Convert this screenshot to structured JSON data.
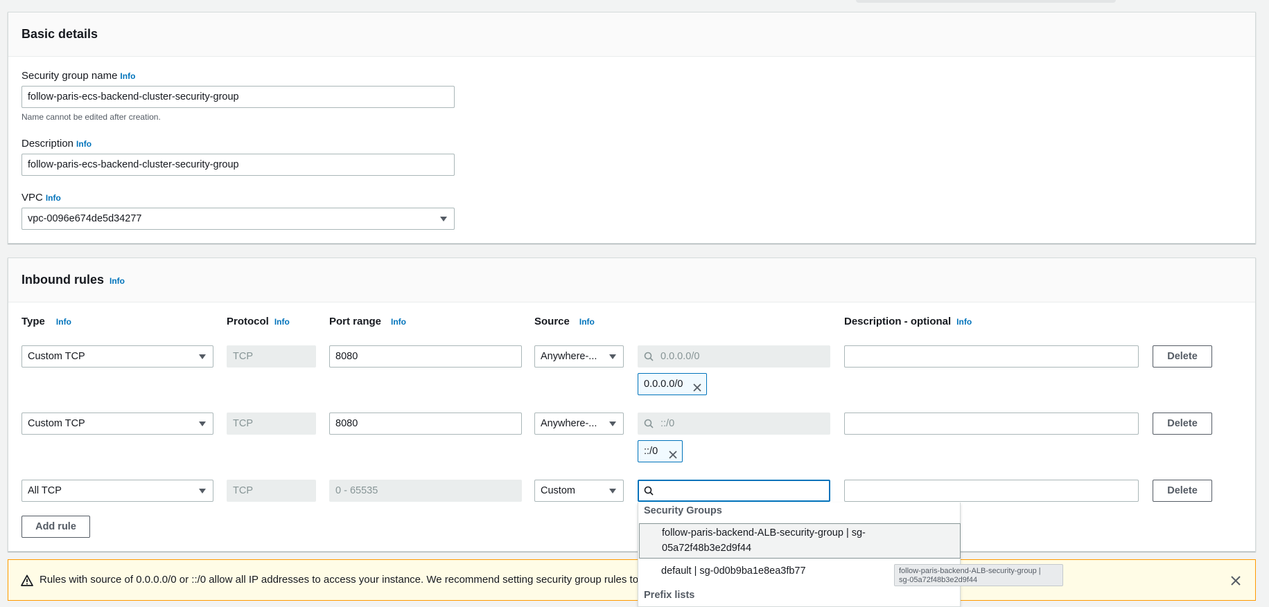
{
  "basic_details": {
    "title": "Basic details",
    "name_label": "Security group name",
    "name_value": "follow-paris-ecs-backend-cluster-security-group",
    "name_hint": "Name cannot be edited after creation.",
    "description_label": "Description",
    "description_value": "follow-paris-ecs-backend-cluster-security-group",
    "vpc_label": "VPC",
    "vpc_value": "vpc-0096e674de5d34277"
  },
  "info_link": "Info",
  "inbound": {
    "title": "Inbound rules",
    "columns": {
      "type": "Type",
      "protocol": "Protocol",
      "port_range": "Port range",
      "source": "Source",
      "description": "Description - optional"
    },
    "rules": [
      {
        "type": "Custom TCP",
        "protocol": "TCP",
        "port": "8080",
        "source_type": "Anywhere-...",
        "source_search_placeholder": "0.0.0.0/0",
        "token": "0.0.0.0/0",
        "description": "",
        "delete": "Delete"
      },
      {
        "type": "Custom TCP",
        "protocol": "TCP",
        "port": "8080",
        "source_type": "Anywhere-...",
        "source_search_placeholder": "::/0",
        "token": "::/0",
        "description": "",
        "delete": "Delete"
      },
      {
        "type": "All TCP",
        "protocol": "TCP",
        "port": "0 - 65535",
        "source_type": "Custom",
        "source_search_placeholder": "",
        "description": "",
        "delete": "Delete"
      }
    ],
    "add_rule": "Add rule"
  },
  "dropdown": {
    "group1": "Security Groups",
    "option1_line1": "follow-paris-backend-ALB-security-group | sg-",
    "option1_line2": "05a72f48b3e2d9f44",
    "option2": "default | sg-0d0b9ba1e8ea3fb77",
    "group2": "Prefix lists"
  },
  "tooltip": {
    "line1": "follow-paris-backend-ALB-security-group |",
    "line2": "sg-05a72f48b3e2d9f44"
  },
  "warning": {
    "text": "Rules with source of 0.0.0.0/0 or ::/0 allow all IP addresses to access your instance. We recommend setting security group rules to allow a"
  },
  "colors": {
    "accent": "#0073bb",
    "warning_border": "#ff9900",
    "warning_bg": "#fffce6"
  }
}
